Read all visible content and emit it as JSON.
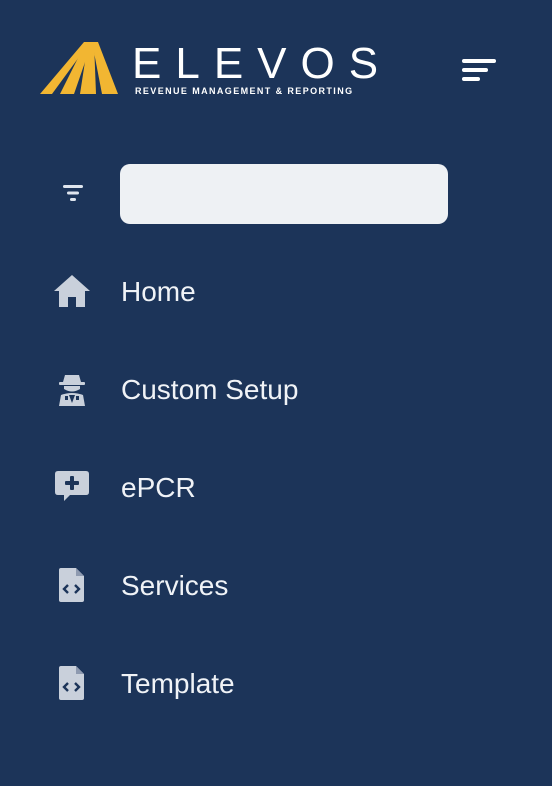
{
  "brand": {
    "name": "ELEVOS",
    "tagline": "REVENUE MANAGEMENT & REPORTING",
    "mark_color": "#f2b632"
  },
  "search": {
    "value": "",
    "placeholder": ""
  },
  "nav": {
    "items": [
      {
        "label": "Home",
        "icon": "home-icon"
      },
      {
        "label": "Custom Setup",
        "icon": "user-secret-icon"
      },
      {
        "label": "ePCR",
        "icon": "comment-medical-icon"
      },
      {
        "label": "Services",
        "icon": "file-code-icon"
      },
      {
        "label": "Template",
        "icon": "file-code-icon"
      }
    ]
  },
  "colors": {
    "background": "#1c3459",
    "icon": "#c9d0db",
    "text": "#f0f3f7"
  }
}
